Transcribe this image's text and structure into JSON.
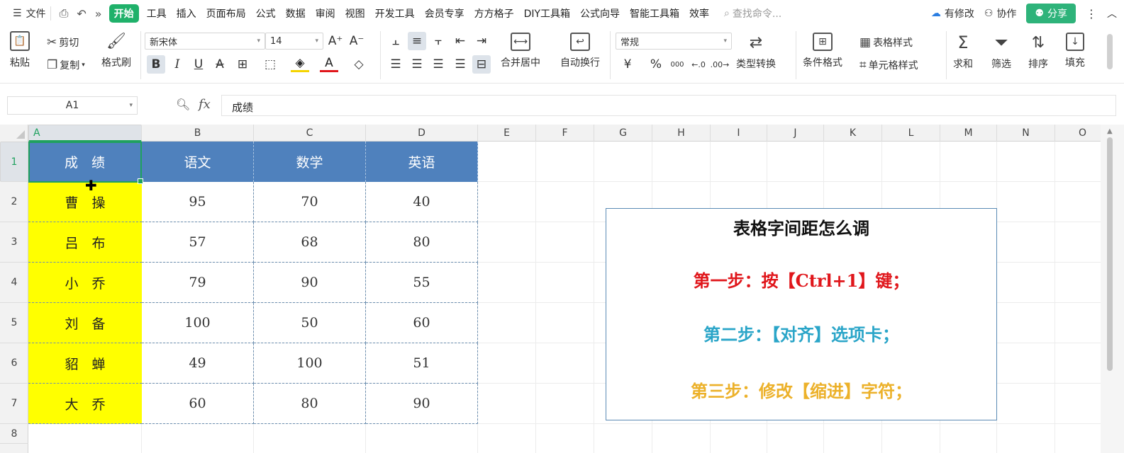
{
  "menubar": {
    "file_label": "文件",
    "tabs": [
      "开始",
      "工具",
      "插入",
      "页面布局",
      "公式",
      "数据",
      "审阅",
      "视图",
      "开发工具",
      "会员专享",
      "方方格子",
      "DIY工具箱",
      "公式向导",
      "智能工具箱",
      "效率"
    ],
    "active_tab": "开始",
    "search_placeholder": "查找命令...",
    "modified_label": "有修改",
    "collab_label": "协作",
    "share_label": "分享"
  },
  "ribbon": {
    "paste": "粘贴",
    "cut": "剪切",
    "copy": "复制",
    "format_painter": "格式刷",
    "font_name": "新宋体",
    "font_size": "14",
    "merge_center": "合并居中",
    "wrap_text": "自动换行",
    "number_format": "常规",
    "type_convert": "类型转换",
    "cond_format": "条件格式",
    "table_style": "表格样式",
    "cell_style": "单元格样式",
    "sum": "求和",
    "filter": "筛选",
    "sort": "排序",
    "fill": "填充",
    "currency_symbol": "¥",
    "percent_symbol": "%",
    "thousands_symbol": "000"
  },
  "formula_bar": {
    "cell_ref": "A1",
    "fx": "fx",
    "content": "成绩"
  },
  "sheet": {
    "columns": [
      "A",
      "B",
      "C",
      "D",
      "E",
      "F",
      "G",
      "H",
      "I",
      "J",
      "K",
      "L",
      "M",
      "N",
      "O"
    ],
    "rows": [
      "1",
      "2",
      "3",
      "4",
      "5",
      "6",
      "7",
      "8"
    ],
    "headers": [
      "成　绩",
      "语文",
      "数学",
      "英语"
    ],
    "data": [
      [
        "曹　操",
        "95",
        "70",
        "40"
      ],
      [
        "吕　布",
        "57",
        "68",
        "80"
      ],
      [
        "小　乔",
        "79",
        "90",
        "55"
      ],
      [
        "刘　备",
        "100",
        "50",
        "60"
      ],
      [
        "貂　蝉",
        "49",
        "100",
        "51"
      ],
      [
        "大　乔",
        "60",
        "80",
        "90"
      ]
    ]
  },
  "textbox": {
    "title": "表格字间距怎么调",
    "step1": "第一步：按【Ctrl+1】键；",
    "step2": "第二步：【对齐】选项卡；",
    "step3": "第三步：修改【缩进】字符；",
    "step1_color": "#e0161b",
    "step2_color": "#2aa5c8",
    "step3_color": "#ecb12a"
  },
  "colors": {
    "accent_green": "#1fb16a",
    "header_blue": "#4f81bd",
    "name_yellow": "#ffff00"
  }
}
